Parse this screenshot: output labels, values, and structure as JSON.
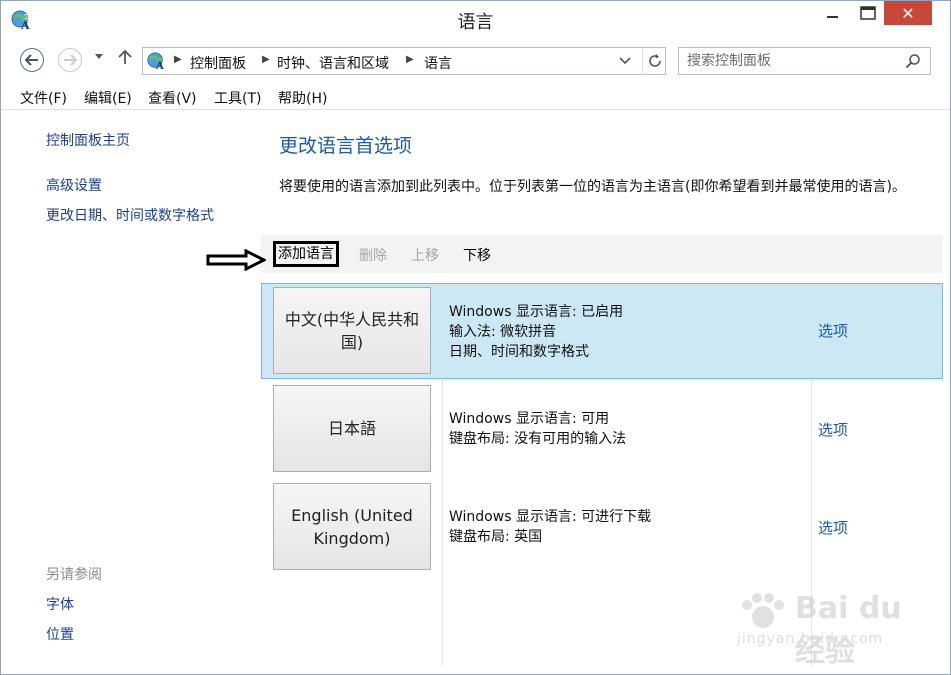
{
  "window": {
    "title": "语言",
    "close_glyph": "✕"
  },
  "nav": {
    "breadcrumbs": [
      "控制面板",
      "时钟、语言和区域",
      "语言"
    ],
    "search_placeholder": "搜索控制面板"
  },
  "menu": [
    "文件(F)",
    "编辑(E)",
    "查看(V)",
    "工具(T)",
    "帮助(H)"
  ],
  "sidebar": {
    "links": [
      "控制面板主页",
      "高级设置",
      "更改日期、时间或数字格式"
    ],
    "see_also_title": "另请参阅",
    "see_also": [
      "字体",
      "位置"
    ]
  },
  "main": {
    "heading": "更改语言首选项",
    "description": "将要使用的语言添加到此列表中。位于列表第一位的语言为主语言(即你希望看到并最常使用的语言)。",
    "toolbar": {
      "add": "添加语言",
      "remove": "删除",
      "up": "上移",
      "down": "下移"
    },
    "languages": [
      {
        "name": "中文(中华人民共和国)",
        "lines": [
          "Windows 显示语言: 已启用",
          "输入法: 微软拼音",
          "日期、时间和数字格式"
        ],
        "options": "选项",
        "selected": true
      },
      {
        "name": "日本語",
        "lines": [
          "Windows 显示语言: 可用",
          "键盘布局: 没有可用的输入法"
        ],
        "options": "选项",
        "selected": false
      },
      {
        "name": "English (United Kingdom)",
        "lines": [
          "Windows 显示语言: 可进行下载",
          "键盘布局: 英国"
        ],
        "options": "选项",
        "selected": false
      }
    ]
  },
  "watermark": {
    "brand": "Bai du 经验",
    "url": "jingyan.baidu.com"
  },
  "colors": {
    "link": "#1f5aa6",
    "selected_row": "#cce8f4",
    "close_button": "#c7473b"
  }
}
